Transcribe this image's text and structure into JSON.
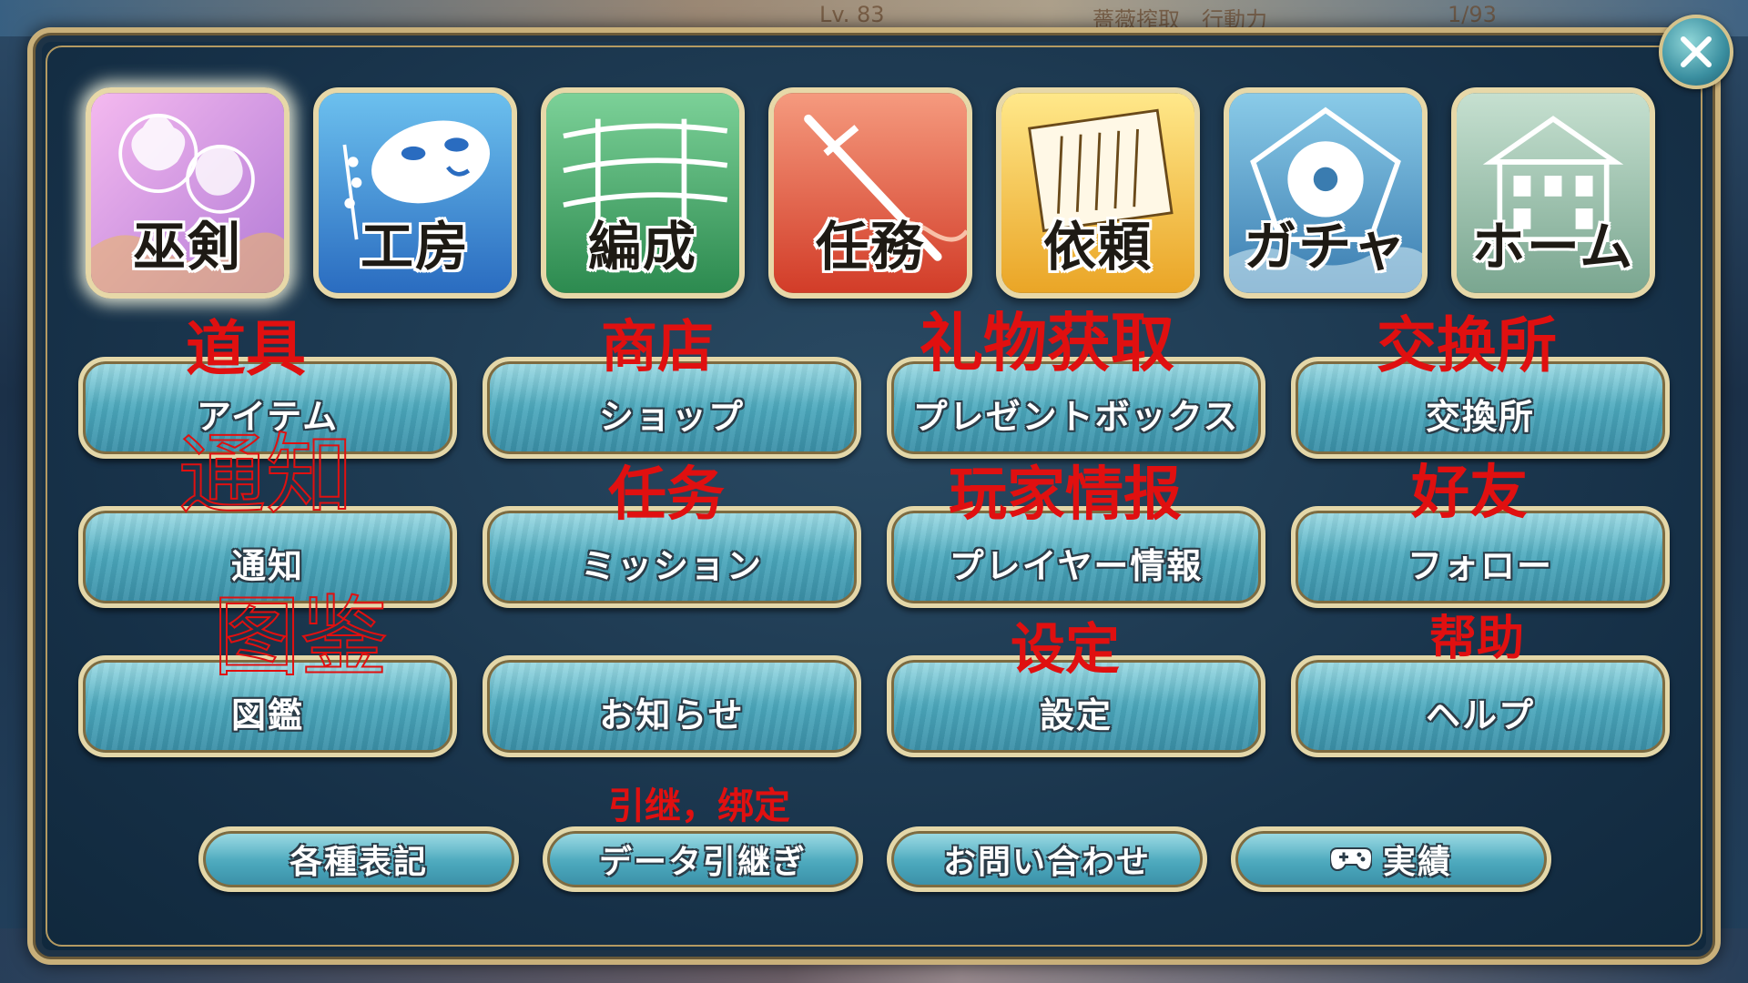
{
  "background": {
    "status_left": "Lv. 83",
    "status_mid": "薔薇搾取　行動力",
    "status_right": "1/93"
  },
  "tiles": [
    {
      "label": "巫剣",
      "icon": "flower-icon",
      "colors": [
        "#e9a7e6",
        "#b77ad0"
      ],
      "selected": true
    },
    {
      "label": "工房",
      "icon": "mask-icon",
      "colors": [
        "#5fb0e6",
        "#2b6fc4"
      ]
    },
    {
      "label": "編成",
      "icon": "sword-rack-icon",
      "colors": [
        "#6cc78a",
        "#2f8f52"
      ]
    },
    {
      "label": "任務",
      "icon": "katana-icon",
      "colors": [
        "#f0836a",
        "#d0402c"
      ]
    },
    {
      "label": "依頼",
      "icon": "letter-icon",
      "colors": [
        "#ffe37a",
        "#e8a828"
      ]
    },
    {
      "label": "ガチャ",
      "icon": "pentagon-flower-icon",
      "colors": [
        "#7fc0e0",
        "#3b82b6"
      ]
    },
    {
      "label": "ホーム",
      "icon": "house-icon",
      "colors": [
        "#b8d6c6",
        "#7aa892"
      ]
    }
  ],
  "menu": [
    [
      "アイテム",
      "ショップ",
      "プレゼントボックス",
      "交換所"
    ],
    [
      "通知",
      "ミッション",
      "プレイヤー情報",
      "フォロー"
    ],
    [
      "図鑑",
      "お知らせ",
      "設定",
      "ヘルプ"
    ]
  ],
  "bottom_buttons": [
    "各種表記",
    "データ引継ぎ",
    "お問い合わせ",
    "実績"
  ],
  "annotations": [
    "道具",
    "商店",
    "礼物获取",
    "交换所",
    "通知",
    "任务",
    "玩家情报",
    "好友",
    "图鉴",
    "设定",
    "帮助",
    "引继，绑定"
  ],
  "close_icon": "close-icon"
}
